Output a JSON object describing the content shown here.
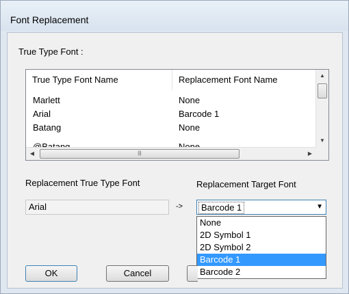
{
  "window": {
    "title": "Font Replacement"
  },
  "section_label": "True Type Font :",
  "table": {
    "headers": [
      "True Type Font Name",
      "Replacement Font Name"
    ],
    "rows": [
      [
        "Marlett",
        "None"
      ],
      [
        "Arial",
        "Barcode 1"
      ],
      [
        "Batang",
        "None"
      ],
      [
        "@Batang",
        "None"
      ]
    ]
  },
  "replacement_true_type_font": {
    "label": "Replacement True Type Font",
    "value": "Arial"
  },
  "arrow_text": "->",
  "replacement_target_font": {
    "label": "Replacement Target Font",
    "selected": "Barcode 1",
    "options": [
      "None",
      "2D Symbol 1",
      "2D Symbol 2",
      "Barcode 1",
      "Barcode 2"
    ],
    "highlighted_index": 3
  },
  "buttons": {
    "ok": "OK",
    "cancel": "Cancel"
  },
  "icons": {
    "scroll_up": "▲",
    "scroll_down": "▼",
    "scroll_left": "◀",
    "scroll_right": "▶",
    "thumb_grip": "|||",
    "dropdown_arrow": "▼"
  }
}
